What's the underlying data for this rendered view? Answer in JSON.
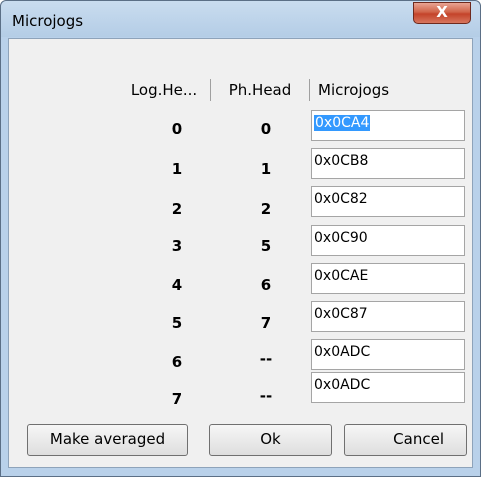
{
  "window": {
    "title": "Microjogs",
    "close_label": "X"
  },
  "table": {
    "headers": [
      "Log.He...",
      "Ph.Head",
      "Microjogs"
    ],
    "rows": [
      {
        "log": "0",
        "ph": "0",
        "jog": "0x0CA4"
      },
      {
        "log": "1",
        "ph": "1",
        "jog": "0x0CB8"
      },
      {
        "log": "2",
        "ph": "2",
        "jog": "0x0C82"
      },
      {
        "log": "3",
        "ph": "5",
        "jog": "0x0C90"
      },
      {
        "log": "4",
        "ph": "6",
        "jog": "0x0CAE"
      },
      {
        "log": "5",
        "ph": "7",
        "jog": "0x0C87"
      },
      {
        "log": "6",
        "ph": "--",
        "jog": "0x0ADC"
      },
      {
        "log": "7",
        "ph": "--",
        "jog": "0x0ADC"
      }
    ]
  },
  "buttons": {
    "make_averaged": "Make averaged",
    "ok": "Ok",
    "cancel": "Cancel"
  }
}
